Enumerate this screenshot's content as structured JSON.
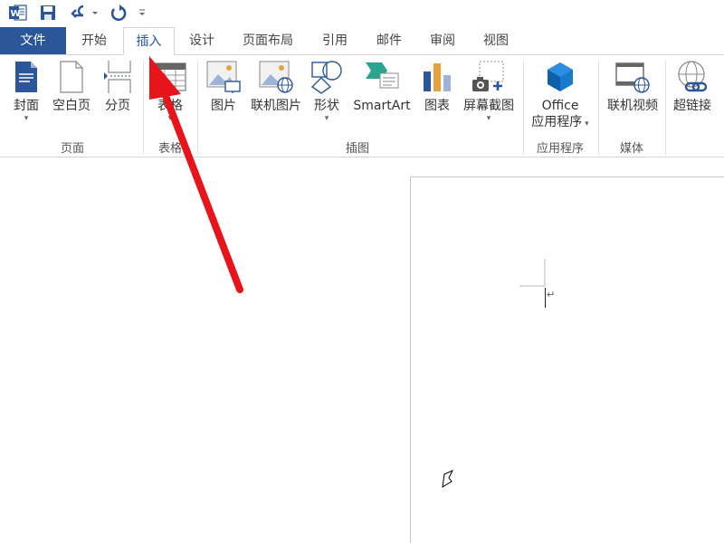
{
  "tabs": {
    "file": "文件",
    "home": "开始",
    "insert": "插入",
    "design": "设计",
    "layout": "页面布局",
    "references": "引用",
    "mailings": "邮件",
    "review": "审阅",
    "view": "视图"
  },
  "ribbon": {
    "cover": "封面",
    "blank_page": "空白页",
    "page_break": "分页",
    "table": "表格",
    "picture": "图片",
    "online_picture": "联机图片",
    "shapes": "形状",
    "smartart": "SmartArt",
    "chart": "图表",
    "screenshot": "屏幕截图",
    "office_line1": "Office",
    "office_line2": "应用程序",
    "online_video": "联机视频",
    "hyperlink": "超链接"
  },
  "groups": {
    "pages": "页面",
    "tables": "表格",
    "illustrations": "插图",
    "apps": "应用程序",
    "media": "媒体"
  },
  "document": {
    "paragraph_mark": "↵"
  },
  "colors": {
    "file_tab": "#2b579a",
    "arrow": "#e8141c",
    "accent_blue": "#2b579a"
  }
}
